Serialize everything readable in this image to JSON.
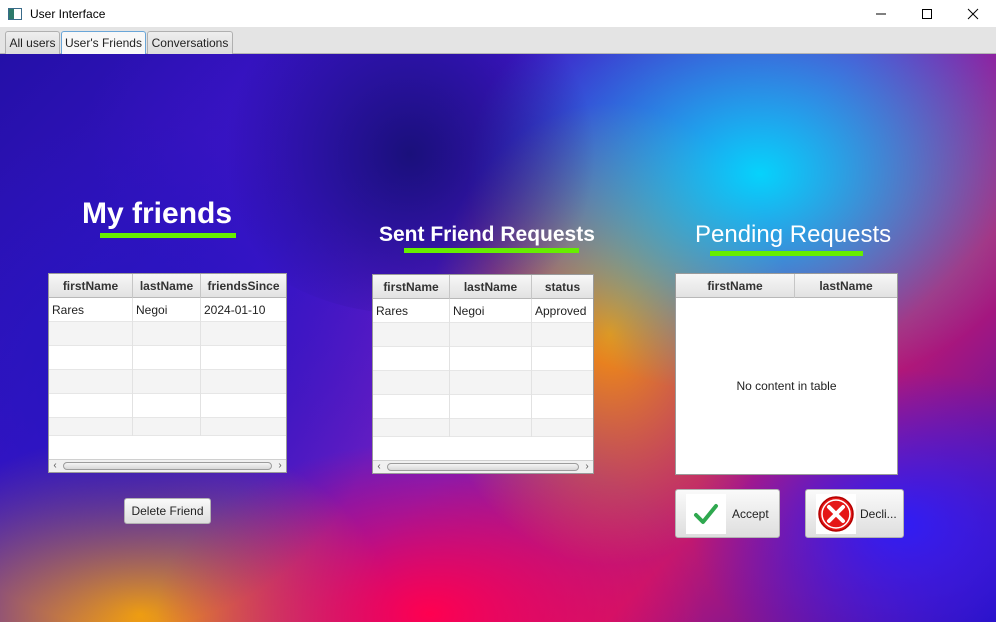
{
  "window": {
    "title": "User Interface",
    "minimize": "—",
    "maximize": "☐",
    "close": "✕"
  },
  "tabs": [
    {
      "label": "All users"
    },
    {
      "label": "User's Friends"
    },
    {
      "label": "Conversations"
    }
  ],
  "friends": {
    "heading": "My friends",
    "columns": [
      "firstName",
      "lastName",
      "friendsSince"
    ],
    "rows": [
      [
        "Rares",
        "Negoi",
        "2024-01-10"
      ]
    ],
    "delete_label": "Delete Friend"
  },
  "sent": {
    "heading": "Sent Friend Requests",
    "columns": [
      "firstName",
      "lastName",
      "status"
    ],
    "rows": [
      [
        "Rares",
        "Negoi",
        "Approved"
      ]
    ]
  },
  "pending": {
    "heading": "Pending Requests",
    "columns": [
      "firstName",
      "lastName"
    ],
    "empty_text": "No content in table",
    "accept_label": "Accept",
    "decline_label": "Decli..."
  },
  "colors": {
    "accent_underline": "#66ee00",
    "accept_check": "#2fa84f",
    "decline_red": "#e51616"
  },
  "icons": {
    "accept": "checkmark-icon",
    "decline": "x-circle-icon"
  }
}
